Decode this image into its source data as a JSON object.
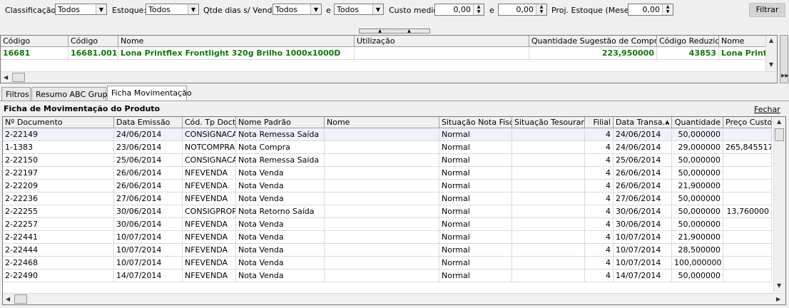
{
  "filters": {
    "classificacao_label": "Classificação:",
    "classificacao_value": "Todos",
    "estoque_label": "Estoque:",
    "estoque_value": "Todos",
    "qtde_label": "Qtde dias s/ Vender",
    "qtde_value1": "Todos",
    "e1": "e",
    "qtde_value2": "Todos",
    "custo_label": "Custo medio",
    "custo_value1": "0,00",
    "e2": "e",
    "custo_value2": "0,00",
    "proj_label": "Proj. Estoque (Meses)",
    "proj_value": "0,00",
    "filtrar_label": "Filtrar"
  },
  "top_grid": {
    "headers": [
      "Código",
      "Código",
      "Nome",
      "Utilização",
      "Quantidade Sugestão de Compra",
      "Código Reduzido",
      "Nome"
    ],
    "row": [
      "16681",
      "16681.001",
      "Lona Printflex Frontlight 320g Brilho 1000x1000D",
      "",
      "223,950000",
      "43853",
      "Lona Printf"
    ]
  },
  "tabs": [
    "Filtros",
    "Resumo ABC Grupo",
    "Ficha Movimentação"
  ],
  "panel": {
    "title": "Ficha de Movimentação do Produto",
    "close_label": "Fechar"
  },
  "main_grid": {
    "headers": [
      "Nº Documento",
      "Data Emissão",
      "Cód. Tp Docto",
      "Nome Padrão",
      "Nome",
      "Situação Nota Fiscal",
      "Situação Tesouraria",
      "Filial",
      "Data Transa...",
      "Quantidade",
      "Preço Custo"
    ],
    "rows": [
      [
        "2-22149",
        "24/06/2014",
        "CONSIGNACA",
        "Nota Remessa Saída",
        "",
        "Normal",
        "",
        "4",
        "24/06/2014",
        "50,000000",
        ""
      ],
      [
        "1-1383",
        "23/06/2014",
        "NOTCOMPRA",
        "Nota Compra",
        "",
        "Normal",
        "",
        "4",
        "24/06/2014",
        "29,000000",
        "265,845517"
      ],
      [
        "2-22150",
        "25/06/2014",
        "CONSIGNACA",
        "Nota Remessa Saída",
        "",
        "Normal",
        "",
        "4",
        "25/06/2014",
        "50,000000",
        ""
      ],
      [
        "2-22197",
        "26/06/2014",
        "NFEVENDA",
        "Nota Venda",
        "",
        "Normal",
        "",
        "4",
        "26/06/2014",
        "50,000000",
        ""
      ],
      [
        "2-22209",
        "26/06/2014",
        "NFEVENDA",
        "Nota Venda",
        "",
        "Normal",
        "",
        "4",
        "26/06/2014",
        "21,900000",
        ""
      ],
      [
        "2-22236",
        "27/06/2014",
        "NFEVENDA",
        "Nota Venda",
        "",
        "Normal",
        "",
        "4",
        "27/06/2014",
        "50,000000",
        ""
      ],
      [
        "2-22255",
        "30/06/2014",
        "CONSIGPROP",
        "Nota Retorno Saída",
        "",
        "Normal",
        "",
        "4",
        "30/06/2014",
        "50,000000",
        "13,760000"
      ],
      [
        "2-22257",
        "30/06/2014",
        "NFEVENDA",
        "Nota Venda",
        "",
        "Normal",
        "",
        "4",
        "30/06/2014",
        "50,000000",
        ""
      ],
      [
        "2-22441",
        "10/07/2014",
        "NFEVENDA",
        "Nota Venda",
        "",
        "Normal",
        "",
        "4",
        "10/07/2014",
        "21,900000",
        ""
      ],
      [
        "2-22444",
        "10/07/2014",
        "NFEVENDA",
        "Nota Venda",
        "",
        "Normal",
        "",
        "4",
        "10/07/2014",
        "28,500000",
        ""
      ],
      [
        "2-22468",
        "10/07/2014",
        "NFEVENDA",
        "Nota Venda",
        "",
        "Normal",
        "",
        "4",
        "10/07/2014",
        "100,000000",
        ""
      ],
      [
        "2-22490",
        "14/07/2014",
        "NFEVENDA",
        "Nota Venda",
        "",
        "Normal",
        "",
        "4",
        "14/07/2014",
        "50,000000",
        ""
      ]
    ]
  }
}
